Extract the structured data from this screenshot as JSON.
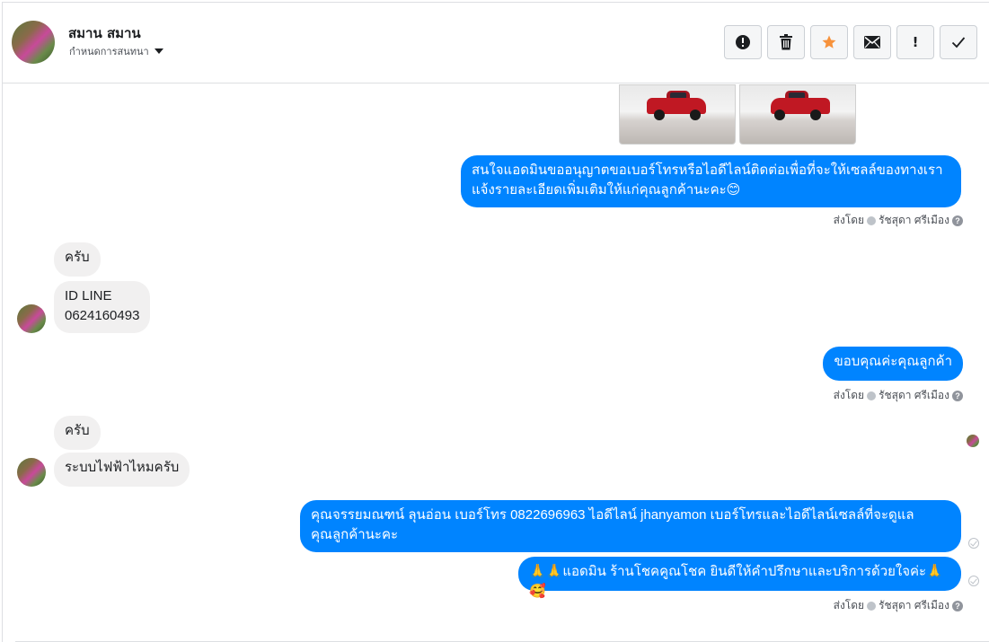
{
  "header": {
    "contact_name": "สมาน สมาน",
    "assign_label": "กำหนดการสนทนา"
  },
  "toolbar": {
    "buttons": [
      {
        "name": "report",
        "icon": "alert-circle-icon"
      },
      {
        "name": "delete",
        "icon": "trash-icon"
      },
      {
        "name": "star",
        "icon": "star-icon",
        "color": "#f7923b"
      },
      {
        "name": "mark-unread",
        "icon": "envelope-icon"
      },
      {
        "name": "follow-up",
        "icon": "exclamation-icon",
        "glyph": "!"
      },
      {
        "name": "mark-done",
        "icon": "check-icon"
      }
    ]
  },
  "colors": {
    "outgoing_bubble": "#0084ff",
    "incoming_bubble": "#f1f0f0",
    "star": "#f7923b"
  },
  "messages": [
    {
      "dir": "out",
      "type": "images",
      "count": 2
    },
    {
      "dir": "out",
      "lines": [
        "สนใจแอดมินขออนุญาตขอเบอร์โทรหรือไอดีไลน์ติดต่อเพื่อที่จะให้เซลล์ของทางเรา",
        "แจ้งรายละเอียดเพิ่มเติมให้แก่คุณลูกค้านะคะ😊"
      ]
    },
    {
      "dir": "in",
      "text": "ครับ"
    },
    {
      "dir": "in",
      "lines": [
        "ID  LINE",
        "0624160493"
      ]
    },
    {
      "dir": "out",
      "text": "ขอบคุณค่ะคุณลูกค้า"
    },
    {
      "dir": "in",
      "text": "ครับ"
    },
    {
      "dir": "in",
      "text": "ระบบไฟฟ้าไหมครับ"
    },
    {
      "dir": "out",
      "lines": [
        "คุณจรรยมณฑน์ ลุนอ่อน เบอร์โทร 0822696963  ไอดีไลน์  jhanyamon   เบอร์โทรและไอดีไลน์เซลล์ที่จะดูแล",
        "คุณลูกค้านะคะ"
      ]
    },
    {
      "dir": "out",
      "text": "🙏🙏แอดมิน ร้านโชคคูณโชค ยินดีให้คำปรึกษาและบริการด้วยใจค่ะ🙏🥰"
    }
  ],
  "sent_by": {
    "prefix": "ส่งโดย",
    "agent": "รัชสุดา ศรีเมือง",
    "help": "?"
  }
}
